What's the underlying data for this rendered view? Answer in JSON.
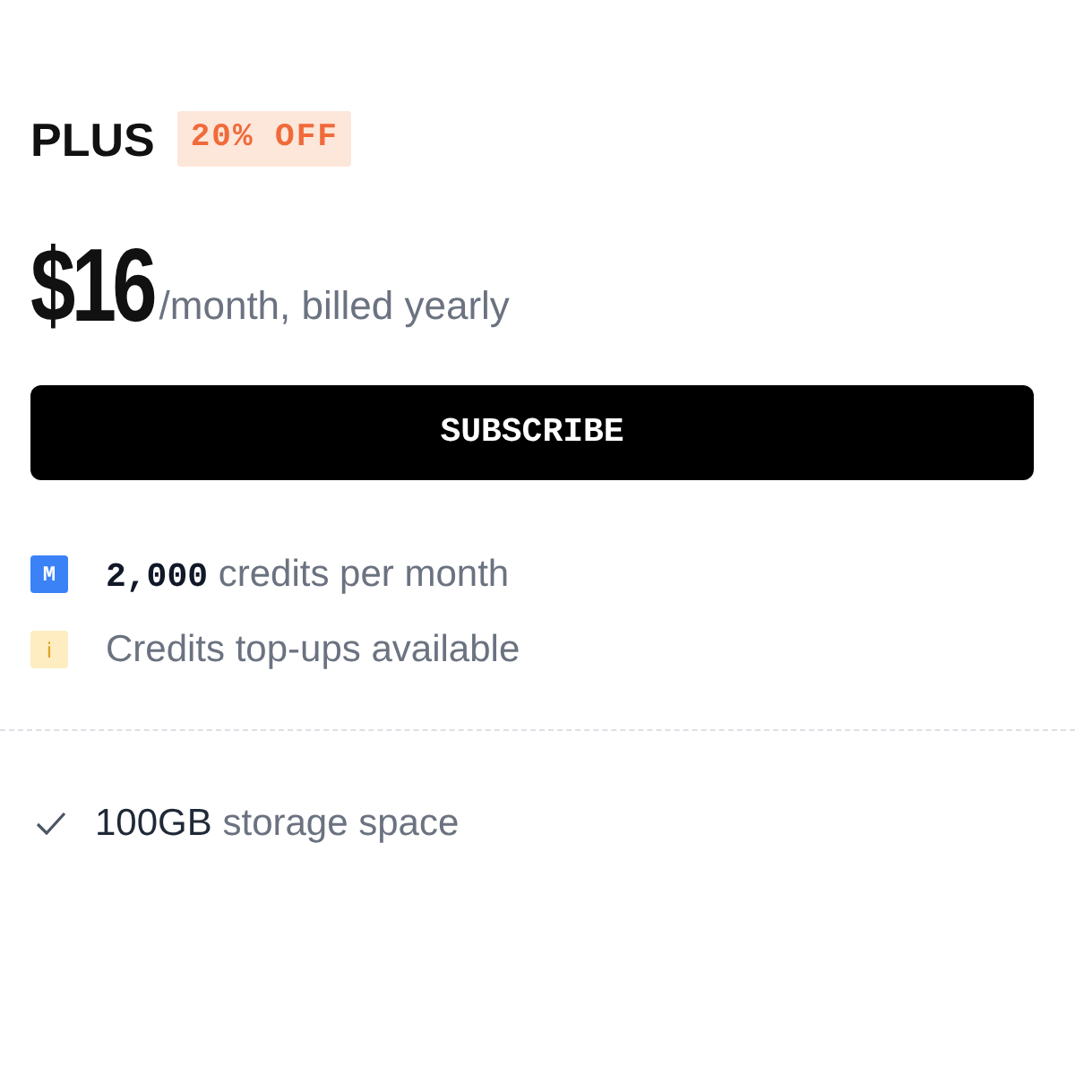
{
  "plan": {
    "name": "PLUS",
    "discount": "20% OFF"
  },
  "price": {
    "amount": "$16",
    "period": "/month, billed yearly"
  },
  "subscribe_button": {
    "label": "SUBSCRIBE"
  },
  "credit_features": [
    {
      "kind": "credits",
      "icon_text": "M",
      "highlight": "2,000",
      "text": "credits per month"
    },
    {
      "kind": "info",
      "icon_text": "i",
      "text": "Credits top-ups available"
    }
  ],
  "features": [
    {
      "kind": "check",
      "highlight": "100GB",
      "text": "storage space"
    }
  ]
}
